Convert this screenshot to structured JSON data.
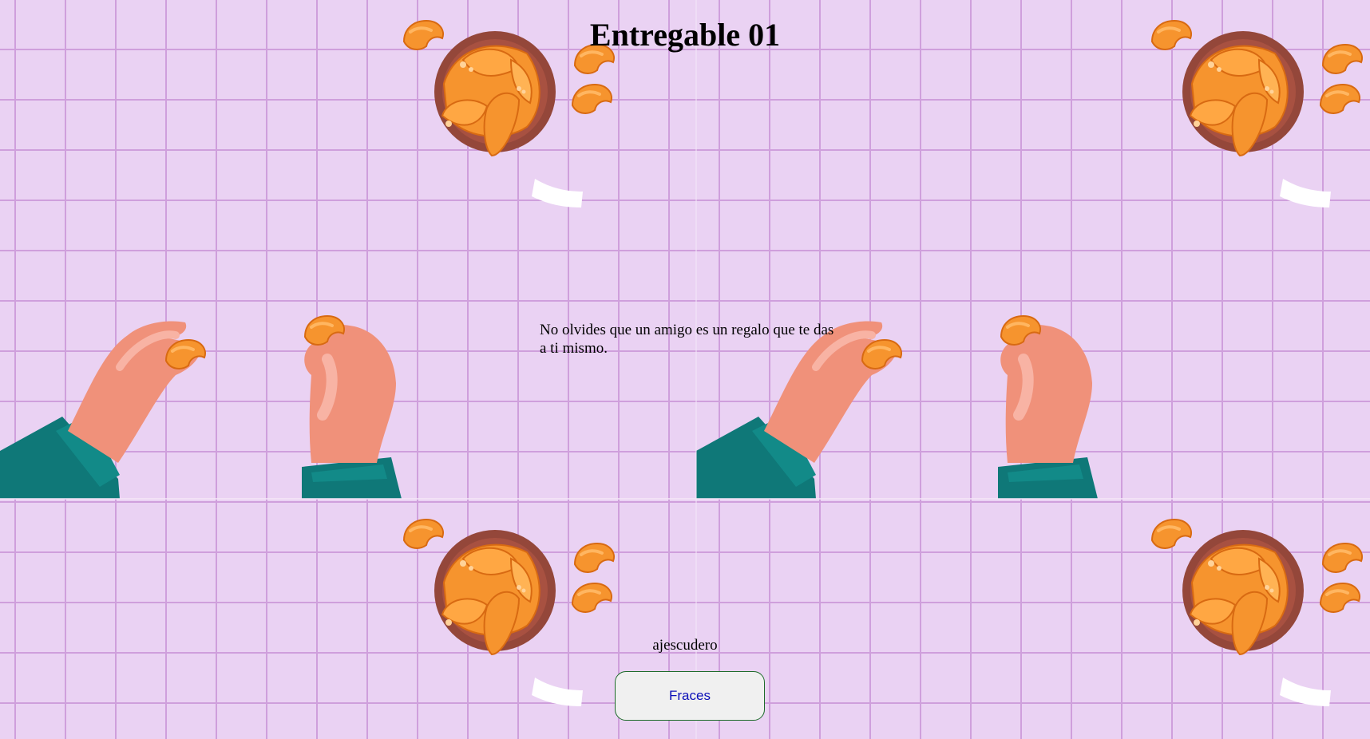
{
  "page": {
    "title": "Entregable 01",
    "phrase": "No olvides que un amigo es un regalo que te das a ti mismo.",
    "author": "ajescudero",
    "button_label": "Fraces"
  },
  "colors": {
    "background": "#ead2f3",
    "grid_line": "#cf9fdc",
    "cookie": "#f6942e",
    "bowl": "#94473a",
    "hand": "#f0917a",
    "sleeve": "#0f7878",
    "button_border": "#1d6b2a",
    "button_text": "#0b0fb8"
  },
  "icons": [
    "fortune-cookie-bowl-illustration",
    "fortune-cookie-icon",
    "fortune-paper-slip",
    "hand-holding-cookie-illustration"
  ]
}
